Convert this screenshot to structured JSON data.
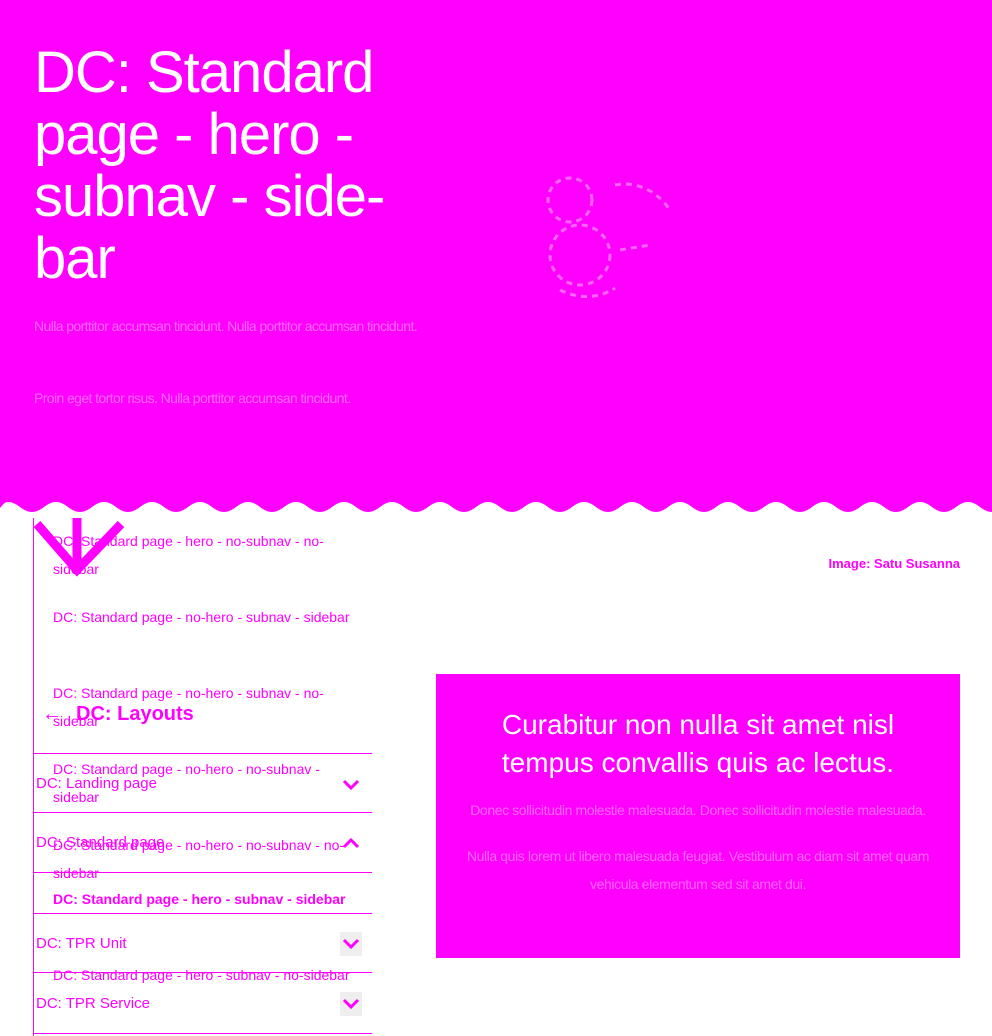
{
  "hero": {
    "title": "DC: Standard page - hero - subnav - side-bar",
    "paragraph_1": "Nulla porttitor accumsan tincidunt. Nulla porttitor accumsan tincidunt.",
    "paragraph_2": "Proin eget tortor risus. Nulla porttitor accumsan tincidunt.",
    "background_color": "#ff00ff"
  },
  "subnav": {
    "items": [
      {
        "label": "DC: Standard page - hero - no-subnav - no-sidebar",
        "active": false
      },
      {
        "label": "DC: Standard page - no-hero - subnav - sidebar",
        "active": false
      },
      {
        "label": "DC: Standard page - no-hero - subnav - no-sidebar",
        "active": false
      },
      {
        "label": "DC: Standard page - no-hero - no-subnav - sidebar",
        "active": false
      },
      {
        "label": "DC: Standard page - no-hero - no-subnav - no-sidebar",
        "active": false
      },
      {
        "label": "DC: Standard page - hero - subnav - sidebar",
        "active": true
      },
      {
        "label": "DC: Standard page - hero - subnav - no-sidebar",
        "active": false
      }
    ]
  },
  "layouts_nav": {
    "back_label": "DC: Layouts",
    "back_icon": "arrow-left-icon",
    "sections": [
      {
        "label": "DC: Landing page",
        "icon": "chevron-down-icon"
      },
      {
        "label": "DC: Standard page",
        "icon": "chevron-up-icon"
      },
      {
        "label": "DC: TPR Unit",
        "icon": "chevron-down-icon"
      },
      {
        "label": "DC: TPR Service",
        "icon": "chevron-down-icon"
      }
    ]
  },
  "image_caption": "Image: Satu Susanna",
  "callout": {
    "heading": "Curabitur non nulla sit amet nisl tempus convallis quis ac lectus.",
    "paragraph_1": "Donec sollicitudin molestie malesuada. Donec sollicitudin molestie malesuada.",
    "paragraph_2": "Nulla quis lorem ut libero malesuada feugiat. Vestibulum ac diam sit amet quam vehicula elementum sed sit amet dui."
  }
}
